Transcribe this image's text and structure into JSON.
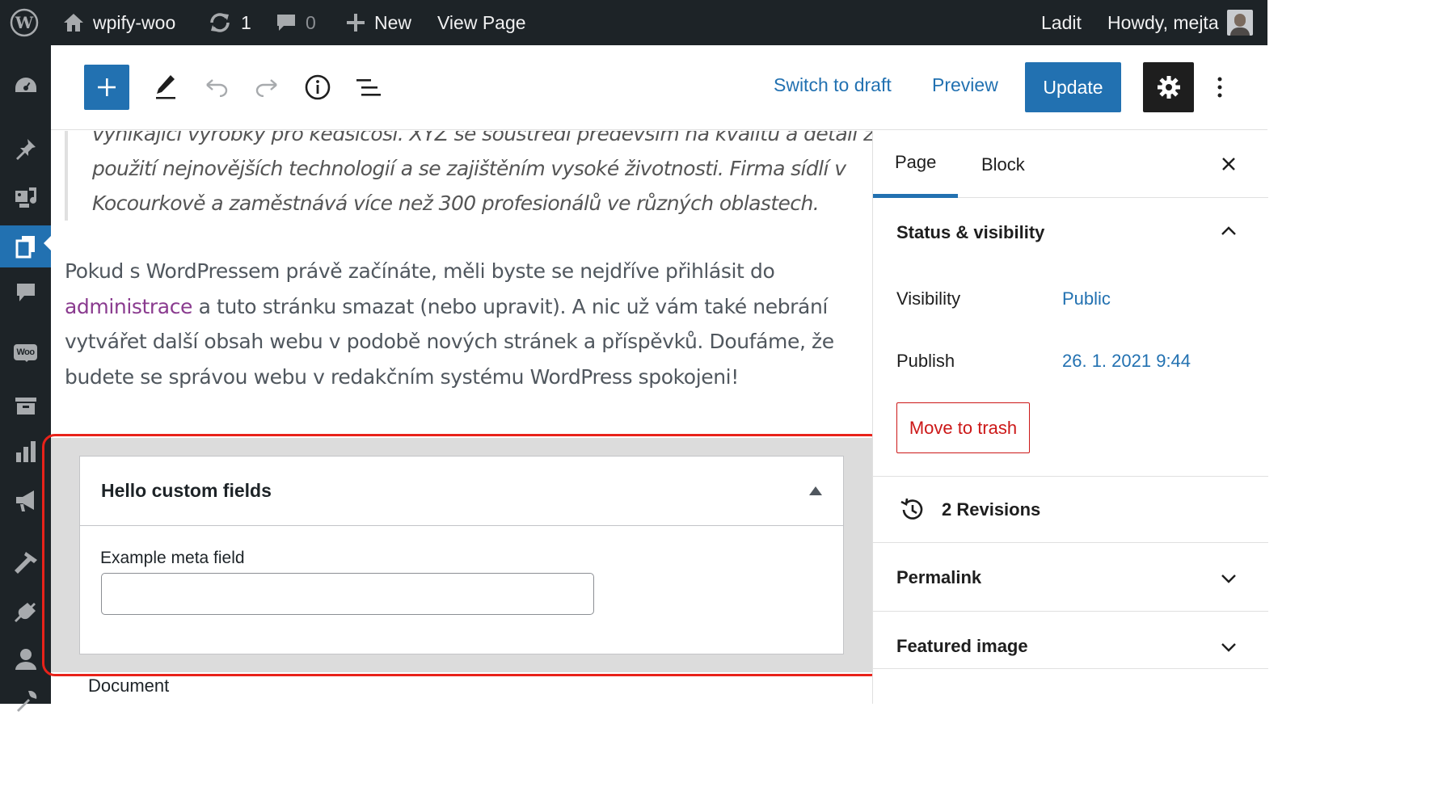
{
  "admin_bar": {
    "site_name": "wpify-woo",
    "updates_count": "1",
    "comments_count": "0",
    "new_label": "New",
    "view_page_label": "View Page",
    "debug_label": "Ladit",
    "greeting": "Howdy, mejta"
  },
  "left_menu": {
    "items": [
      "dashboard-icon",
      "pin-icon",
      "media-icon",
      "pages-icon",
      "comments-icon",
      "woocommerce-icon",
      "archive-icon",
      "analytics-icon",
      "megaphone-icon",
      "appearance-icon",
      "plugins-icon",
      "users-icon",
      "tools-icon"
    ],
    "woo_badge": "Woo",
    "current": "pages-icon"
  },
  "toolbar": {
    "switch_to_draft": "Switch to draft",
    "preview": "Preview",
    "update": "Update"
  },
  "content": {
    "quote_lines": [
      "vynikající výrobky pro kedsicosi. XYZ se soustředí především na kvalitu a detail za",
      "použití nejnovějších technologií a se zajištěním vysoké životnosti. Firma  sídlí v",
      "Kocourkově a zaměstnává více než 300 profesionálů ve různých oblastech."
    ],
    "para_before_link": "Pokud s WordPressem právě začínáte, měli byste se nejdříve přihlásit do ",
    "para_link": "administrace",
    "para_after_link": " a tuto stránku smazat (nebo upravit). A nic už vám také nebrání vytvářet další obsah webu v podobě nových stránek a příspěvků. Doufáme, že budete se správou webu v redakčním systému WordPress spokojeni!"
  },
  "metabox": {
    "title": "Hello custom fields",
    "field_label": "Example meta field",
    "field_value": "",
    "footer_label": "Document"
  },
  "sidebar": {
    "tabs": [
      "Page",
      "Block"
    ],
    "active_tab": "Page",
    "status_title": "Status & visibility",
    "visibility_label": "Visibility",
    "visibility_value": "Public",
    "publish_label": "Publish",
    "publish_value": "26. 1. 2021 9:44",
    "trash_label": "Move to trash",
    "revisions_label": "2 Revisions",
    "permalink_label": "Permalink",
    "featured_image_label": "Featured image"
  },
  "colors": {
    "admin_bg": "#1d2327",
    "accent": "#2271b1",
    "danger": "#cc1818",
    "highlight": "#e8221a",
    "link_purple": "#8a3b8f"
  }
}
